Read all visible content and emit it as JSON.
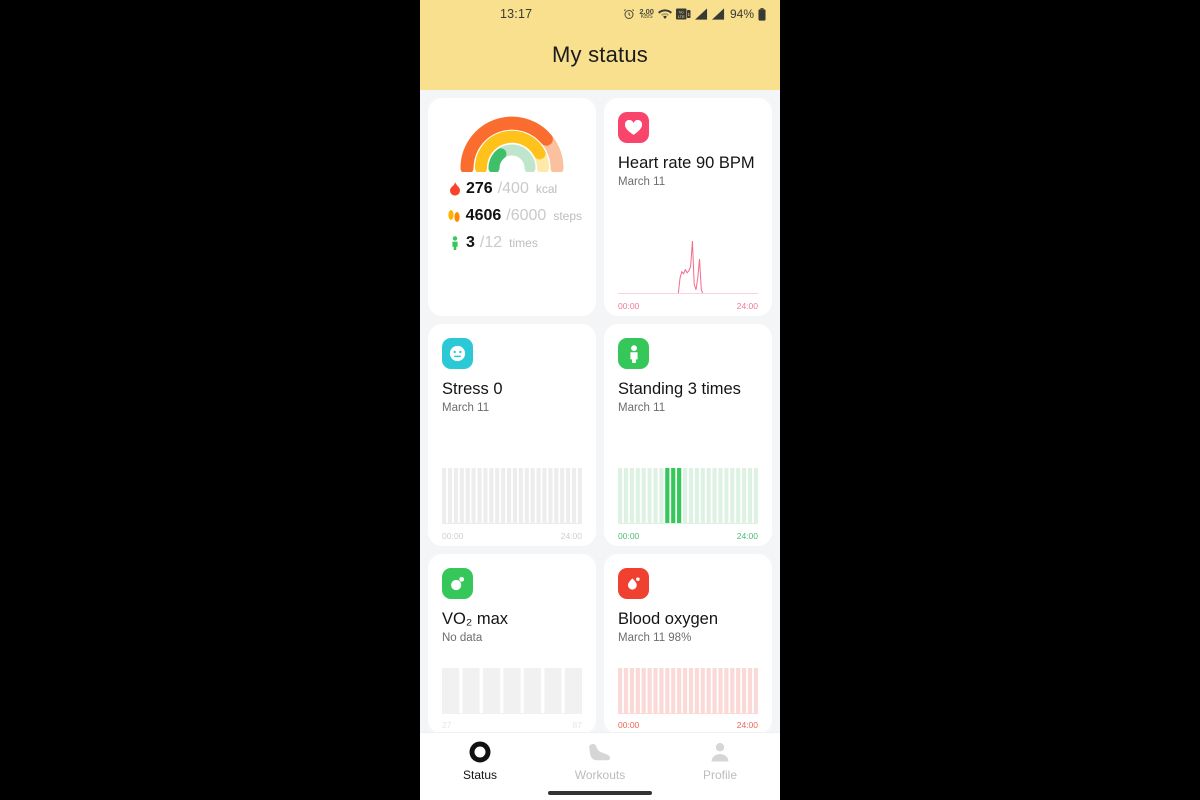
{
  "statusbar": {
    "time": "13:17",
    "data_rate_value": "2.00",
    "data_rate_unit": "KB/S",
    "alarm_icon": "alarm-clock-icon",
    "wifi_icon": "wifi-icon",
    "volte_icon": "volte-icon",
    "volte_label": "VoLTE",
    "signal1_icon": "signal-bars-icon",
    "signal2_icon": "signal-bars-icon",
    "battery_percent": "94%",
    "battery_icon": "battery-icon"
  },
  "header": {
    "title": "My status",
    "bg_color": "#F8E08E"
  },
  "activity": {
    "name": "activity-rings",
    "rings": [
      {
        "label": "calories",
        "color": "#FB6D2E",
        "track": "#FBC19E",
        "percent": 69
      },
      {
        "label": "steps",
        "color": "#FFC21A",
        "track": "#FFE9A8",
        "percent": 77
      },
      {
        "label": "standing",
        "color": "#3FBF6A",
        "track": "#BFE6CC",
        "percent": 25
      }
    ],
    "metrics": [
      {
        "icon": "flame-icon",
        "icon_color": "#F8432B",
        "value": "276",
        "total": "/400",
        "unit": "kcal"
      },
      {
        "icon": "footsteps-icon",
        "icon_color": "#FFB400",
        "value": "4606",
        "total": "/6000",
        "unit": "steps"
      },
      {
        "icon": "person-icon",
        "icon_color": "#35C759",
        "value": "3",
        "total": "/12",
        "unit": "times"
      }
    ]
  },
  "cards": [
    {
      "id": "heart-rate",
      "icon": "heart-icon",
      "icon_bg": "#F9456B",
      "title": "Heart rate 90 BPM",
      "subtitle": "March 11",
      "chart": {
        "type": "line",
        "accent": "#F06D8C",
        "axis_color": "#F07A96",
        "x_start": "00:00",
        "x_end": "24:00",
        "points": [
          0,
          0,
          0,
          0,
          0,
          0,
          0,
          0,
          0,
          0,
          0,
          0,
          0,
          0,
          0,
          0,
          0,
          0,
          0,
          0,
          0,
          0,
          0,
          0,
          0,
          0,
          0,
          0,
          0,
          0,
          0,
          0,
          0,
          0,
          0,
          30,
          42,
          38,
          46,
          40,
          44,
          52,
          100,
          18,
          8,
          30,
          66,
          8,
          0,
          0,
          0,
          0,
          0,
          0,
          0,
          0,
          0,
          0,
          0,
          0,
          0,
          0,
          0,
          0,
          0,
          0,
          0,
          0,
          0,
          0,
          0,
          0,
          0,
          0,
          0,
          0,
          0,
          0,
          0,
          0
        ]
      }
    },
    {
      "id": "stress",
      "icon": "stress-face-icon",
      "icon_bg": "#2BC9D6",
      "title": "Stress 0",
      "subtitle": "March 11",
      "chart": {
        "type": "bar",
        "accent": "#2BC9D6",
        "axis_color": "#cfcfcf",
        "faint_color": "#ededed",
        "x_start": "00:00",
        "x_end": "24:00",
        "bars": 24,
        "active_bars": []
      }
    },
    {
      "id": "standing",
      "icon": "standing-person-icon",
      "icon_bg": "#35C759",
      "title": "Standing 3 times",
      "subtitle": "March 11",
      "chart": {
        "type": "bar",
        "accent": "#35C759",
        "axis_color": "#4BBE73",
        "faint_color": "#DEF2E4",
        "x_start": "00:00",
        "x_end": "24:00",
        "bars": 24,
        "active_bars": [
          8,
          9,
          10
        ]
      }
    },
    {
      "id": "vo2-max",
      "icon": "vo2-bubble-icon",
      "icon_bg": "#35C759",
      "title": "VO₂ max",
      "subtitle": "No data",
      "chart": {
        "type": "bar",
        "accent": "#e9e9e9",
        "axis_color": "#e2e2e2",
        "faint_color": "#f1f1f1",
        "x_start": "27",
        "x_end": "87",
        "bars": 7,
        "active_bars": []
      }
    },
    {
      "id": "blood-oxygen",
      "icon": "blood-drop-icon",
      "icon_bg": "#F0402F",
      "title": "Blood oxygen",
      "subtitle": "March 11 98%",
      "chart": {
        "type": "bar",
        "accent": "#F0402F",
        "axis_color": "#F0635A",
        "faint_color": "#FBD9D6",
        "x_start": "00:00",
        "x_end": "24:00",
        "bars": 24,
        "active_bars": []
      }
    }
  ],
  "nav": {
    "items": [
      {
        "label": "Status",
        "icon": "status-ring-icon",
        "active": true
      },
      {
        "label": "Workouts",
        "icon": "shoe-icon",
        "active": false
      },
      {
        "label": "Profile",
        "icon": "person-avatar-icon",
        "active": false
      }
    ]
  }
}
